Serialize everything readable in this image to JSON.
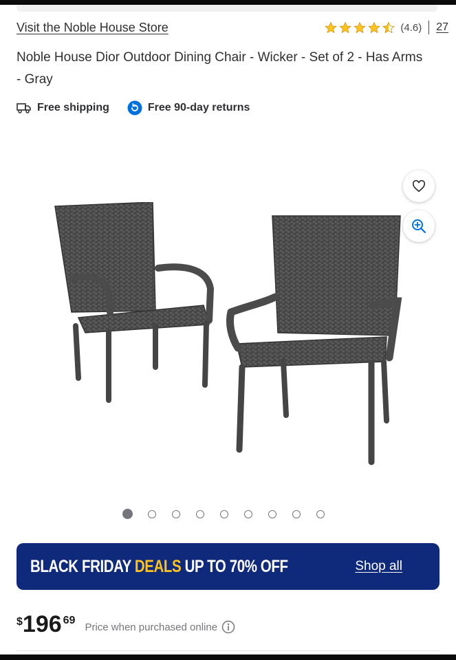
{
  "store": {
    "link_label": "Visit the Noble House Store"
  },
  "rating": {
    "stars": 4.5,
    "value": "(4.6)",
    "review_count": "27",
    "star_color": "#ffc220"
  },
  "product": {
    "title": "Noble House Dior Outdoor Dining Chair - Wicker - Set of 2 - Has Arms - Gray"
  },
  "perks": [
    {
      "label": "Free shipping",
      "icon": "truck-icon"
    },
    {
      "label": "Free 90-day returns",
      "icon": "returns-icon"
    }
  ],
  "gallery": {
    "image_count": 9,
    "active_index": 0,
    "actions": [
      "favorite-heart-icon",
      "zoom-in-icon"
    ]
  },
  "banner": {
    "text_part1": "BLACK FRIDAY ",
    "text_highlight": "DEALS",
    "text_part2": " UP TO 70% OFF",
    "link_label": "Shop all",
    "background": "#0f2a7a",
    "highlight_color": "#ffc220"
  },
  "price": {
    "currency": "$",
    "dollars": "196",
    "cents": "69",
    "note": "Price when purchased online"
  }
}
